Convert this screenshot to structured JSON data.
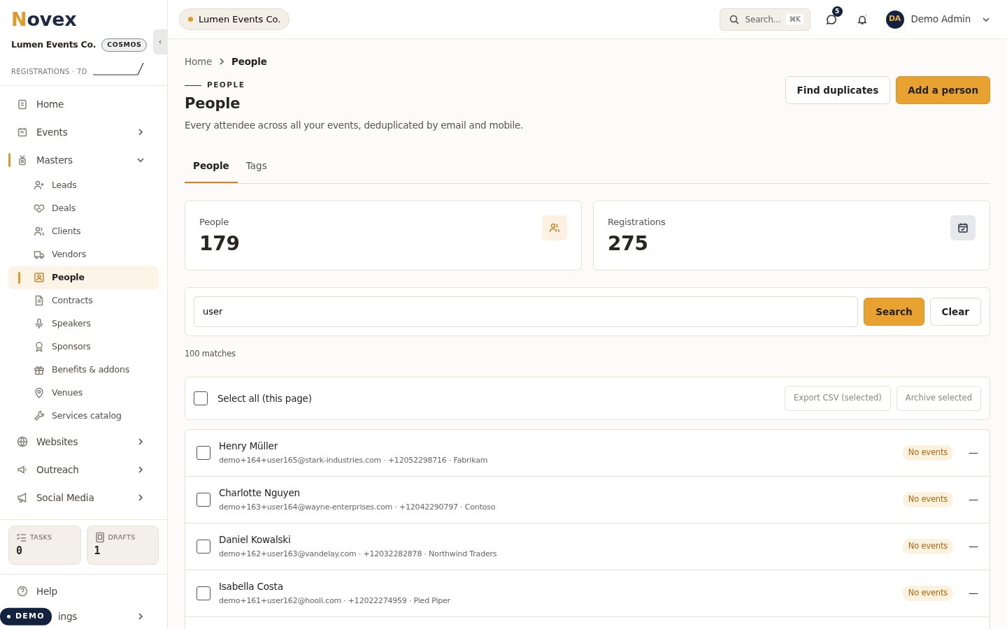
{
  "sidebar": {
    "logo": {
      "first": "N",
      "rest": "ovex"
    },
    "org": {
      "name": "Lumen Events Co.",
      "plan": "COSMOS"
    },
    "stat_label": "REGISTRATIONS · 7D",
    "collapse": "‹",
    "nav": [
      {
        "label": "Home",
        "kind": "item",
        "selected": false
      },
      {
        "label": "Events",
        "kind": "group",
        "expanded": false,
        "selected": false
      },
      {
        "label": "Masters",
        "kind": "group",
        "expanded": true,
        "selected": true,
        "children": [
          {
            "label": "Leads",
            "selected": false
          },
          {
            "label": "Deals",
            "selected": false
          },
          {
            "label": "Clients",
            "selected": false
          },
          {
            "label": "Vendors",
            "selected": false
          },
          {
            "label": "People",
            "selected": true
          },
          {
            "label": "Contracts",
            "selected": false
          },
          {
            "label": "Speakers",
            "selected": false
          },
          {
            "label": "Sponsors",
            "selected": false
          },
          {
            "label": "Benefits & addons",
            "selected": false
          },
          {
            "label": "Venues",
            "selected": false
          },
          {
            "label": "Services catalog",
            "selected": false
          }
        ]
      },
      {
        "label": "Websites",
        "kind": "group",
        "expanded": false,
        "selected": false
      },
      {
        "label": "Outreach",
        "kind": "group",
        "expanded": false,
        "selected": false
      },
      {
        "label": "Social Media",
        "kind": "group",
        "expanded": false,
        "selected": false
      }
    ],
    "counters": [
      {
        "label": "TASKS",
        "value": "0"
      },
      {
        "label": "DRAFTS",
        "value": "1"
      }
    ],
    "footer": [
      {
        "label": "Help",
        "kind": "item"
      },
      {
        "label": "ings",
        "kind": "group"
      }
    ],
    "demo_badge": "DEMO"
  },
  "topbar": {
    "workspace": "Lumen Events Co.",
    "search": {
      "placeholder": "Search...",
      "shortcut": "⌘K"
    },
    "messages_count": "5",
    "user": {
      "initials": "DA",
      "name": "Demo Admin"
    }
  },
  "breadcrumb": [
    {
      "label": "Home",
      "selected": false
    },
    {
      "label": "People",
      "selected": true
    }
  ],
  "header": {
    "eyebrow": "PEOPLE",
    "title": "People",
    "subtitle": "Every attendee across all your events, deduplicated by email and mobile.",
    "actions": [
      {
        "label": "Find duplicates",
        "kind": "secondary"
      },
      {
        "label": "Add a person",
        "kind": "primary"
      }
    ]
  },
  "tabs": [
    {
      "label": "People",
      "selected": true
    },
    {
      "label": "Tags",
      "selected": false
    }
  ],
  "stats": [
    {
      "label": "People",
      "value": "179"
    },
    {
      "label": "Registrations",
      "value": "275"
    }
  ],
  "filter": {
    "value": "user",
    "search": "Search",
    "clear": "Clear"
  },
  "match_count": "100 matches",
  "bulk": {
    "select_all": "Select all (this page)",
    "checked": false,
    "actions": [
      "Export CSV (selected)",
      "Archive selected"
    ]
  },
  "people": [
    {
      "name": "Henry Müller",
      "details": "demo+164+user165@stark-industries.com · +12052298716 · Fabrikam",
      "badge": "No events",
      "action": "—",
      "checked": false
    },
    {
      "name": "Charlotte Nguyen",
      "details": "demo+163+user164@wayne-enterprises.com · +12042290797 · Contoso",
      "badge": "No events",
      "action": "—",
      "checked": false
    },
    {
      "name": "Daniel Kowalski",
      "details": "demo+162+user163@vandelay.com · +12032282878 · Northwind Traders",
      "badge": "No events",
      "action": "—",
      "checked": false
    },
    {
      "name": "Isabella Costa",
      "details": "demo+161+user162@hooli.com · +12022274959 · Pied Piper",
      "badge": "No events",
      "action": "—",
      "checked": false
    }
  ]
}
